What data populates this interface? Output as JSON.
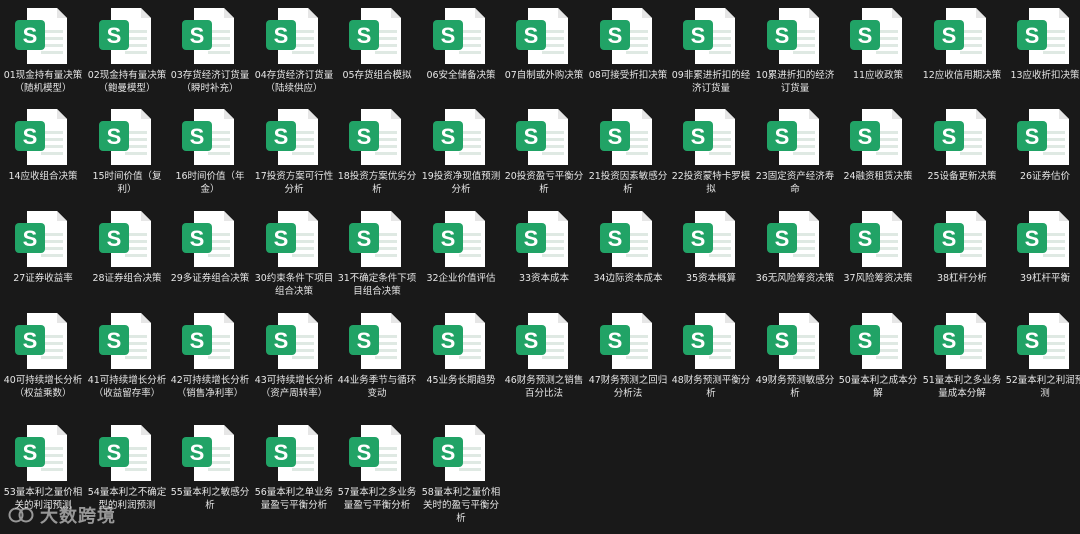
{
  "icon": {
    "name": "spreadsheet-s-icon",
    "letter": "S",
    "accent": "#21A366",
    "page": "#ffffff",
    "fold": "#e6e6e6"
  },
  "files": [
    "01现金持有量决策（随机模型）",
    "02现金持有量决策（鲍曼模型）",
    "03存货经济订货量（瞬时补充）",
    "04存货经济订货量（陆续供应）",
    "05存货组合模拟",
    "06安全储备决策",
    "07自制或外购决策",
    "08可接受折扣决策",
    "09非累进折扣的经济订货量",
    "10累进折扣的经济订货量",
    "11应收政策",
    "12应收信用期决策",
    "13应收折扣决策",
    "14应收组合决策",
    "15时间价值（复利）",
    "16时间价值（年金）",
    "17投资方案可行性分析",
    "18投资方案优劣分析",
    "19投资净现值预测分析",
    "20投资盈亏平衡分析",
    "21投资因素敏感分析",
    "22投资蒙特卡罗模拟",
    "23固定资产经济寿命",
    "24融资租赁决策",
    "25设备更新决策",
    "26证券估价",
    "27证券收益率",
    "28证券组合决策",
    "29多证券组合决策",
    "30约束条件下项目组合决策",
    "31不确定条件下项目组合决策",
    "32企业价值评估",
    "33资本成本",
    "34边际资本成本",
    "35资本概算",
    "36无风险筹资决策",
    "37风险筹资决策",
    "38杠杆分析",
    "39杠杆平衡",
    "40可持续增长分析（权益乘数）",
    "41可持续增长分析（收益留存率）",
    "42可持续增长分析（销售净利率）",
    "43可持续增长分析（资产周转率）",
    "44业务季节与循环变动",
    "45业务长期趋势",
    "46财务预测之销售百分比法",
    "47财务预测之回归分析法",
    "48财务预测平衡分析",
    "49财务预测敏感分析",
    "50量本利之成本分解",
    "51量本利之多业务量成本分解",
    "52量本利之利润预测",
    "53量本利之量价相关的利润预测",
    "54量本利之不确定型的利润预测",
    "55量本利之敏感分析",
    "56量本利之单业务量盈亏平衡分析",
    "57量本利之多业务量盈亏平衡分析",
    "58量本利之量价相关时的盈亏平衡分析"
  ],
  "watermark": {
    "text": "大数跨境"
  }
}
